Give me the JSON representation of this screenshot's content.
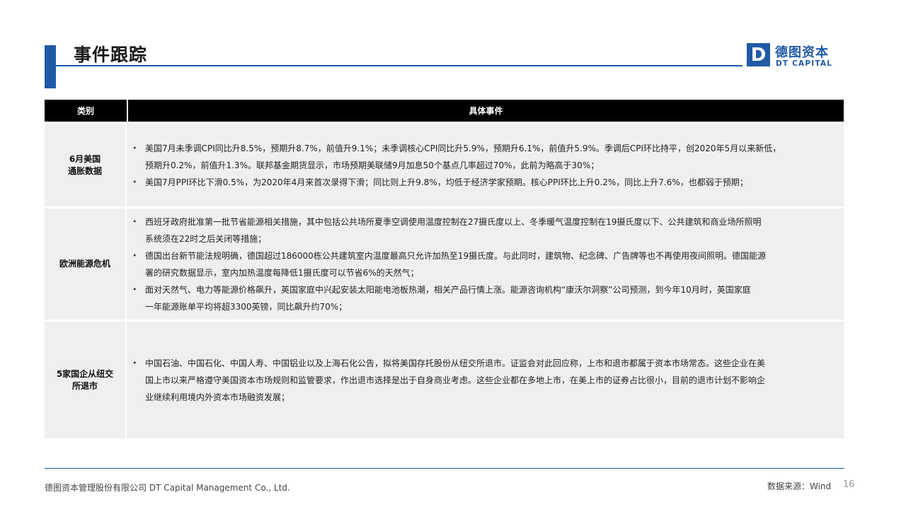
{
  "header": {
    "title": "事件跟踪",
    "logo_mark": "D",
    "logo_cn": "德图资本",
    "logo_en": "DT CAPITAL"
  },
  "table": {
    "headers": [
      "类别",
      "具体事件"
    ],
    "rows": [
      {
        "category_lines": [
          "6月美国",
          "通胀数据"
        ],
        "items": [
          [
            "美国7月未季调CPI同比升8.5%，预期升8.7%，前值升9.1%；未季调核心CPI同比升5.9%，预期升6.1%，前值升5.9%。季调后CPI环比持平，创2020年5月以来新低，",
            "预期升0.2%，前值升1.3%。联邦基金期货显示，市场预期美联储9月加息50个基点几率超过70%，此前为略高于30%；"
          ],
          [
            "美国7月PPI环比下滑0.5%，为2020年4月来首次录得下滑；同比则上升9.8%，均低于经济学家预期。核心PPI环比上升0.2%，同比上升7.6%，也都弱于预期；"
          ]
        ]
      },
      {
        "category_lines": [
          "欧洲能源危机"
        ],
        "items": [
          [
            "西班牙政府批准第一批节省能源相关措施，其中包括公共场所夏季空调使用温度控制在27摄氏度以上、冬季暖气温度控制在19摄氏度以下、公共建筑和商业场所照明",
            "系统须在22时之后关闭等措施；"
          ],
          [
            "德国出台新节能法规明确，德国超过186000栋公共建筑室内温度最高只允许加热至19摄氏度。与此同时，建筑物、纪念碑、广告牌等也不再使用夜间照明。德国能源",
            "署的研究数据显示，室内加热温度每降低1摄氏度可以节省6%的天然气；"
          ],
          [
            "面对天然气、电力等能源价格飙升，英国家庭中兴起安装太阳能电池板热潮，相关产品行情上涨。能源咨询机构“康沃尔洞察”公司预测，到今年10月时，英国家庭",
            "一年能源账单平均将超3300英镑，同比飙升约70%；"
          ]
        ]
      },
      {
        "category_lines": [
          "5家国企从纽交",
          "所退市"
        ],
        "items": [
          [
            "中国石油、中国石化、中国人寿、中国铝业以及上海石化公告，拟将美国存托股份从纽交所退市。证监会对此回应称，上市和退市都属于资本市场常态。这些企业在美",
            "国上市以来严格遵守美国资本市场规则和监管要求，作出退市选择是出于自身商业考虑。这些企业都在多地上市，在美上市的证券占比很小，目前的退市计划不影响企",
            "业继续利用境内外资本市场融资发展；"
          ]
        ]
      }
    ]
  },
  "footer": {
    "company": "德图资本管理股份有限公司  DT Capital  Management  Co., Ltd.",
    "source": "数据来源：Wind",
    "page": "16"
  },
  "colors": {
    "accent": "#1f5aa6",
    "header_bg": "#000000",
    "row_bg": "#efefef"
  }
}
